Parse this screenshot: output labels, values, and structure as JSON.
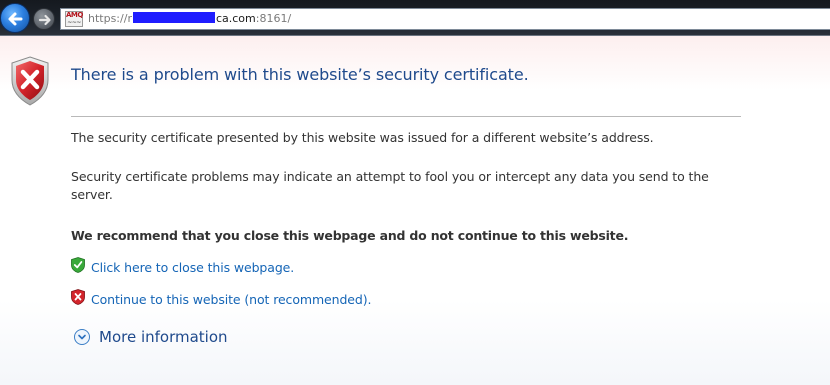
{
  "browser": {
    "url_prefix": "https://",
    "url_partial": "r",
    "url_host": "ca.com",
    "url_port_path": ":8161/",
    "favicon_text_top": "AMQ",
    "favicon_text_bottom": "~~~",
    "back_icon": "back-arrow-icon",
    "forward_icon": "forward-arrow-icon"
  },
  "page": {
    "title": "There is a problem with this website’s security certificate.",
    "paragraph_1": "The security certificate presented by this website was issued for a different website’s address.",
    "paragraph_2": "Security certificate problems may indicate an attempt to fool you or intercept any data you send to the server.",
    "recommendation": "We recommend that you close this webpage and do not continue to this website.",
    "close_link": "Click here to close this webpage.",
    "continue_link": "Continue to this website (not recommended).",
    "more_info_link": "More information"
  },
  "icons": {
    "main": "error-shield-icon",
    "close": "green-shield-check-icon",
    "continue": "red-shield-x-icon",
    "more_info": "expand-chevron-icon"
  },
  "colors": {
    "title": "#1f4a8c",
    "link": "#1565b6",
    "text": "#333333",
    "error_red": "#c8171e",
    "safe_green": "#2e9b2e"
  }
}
